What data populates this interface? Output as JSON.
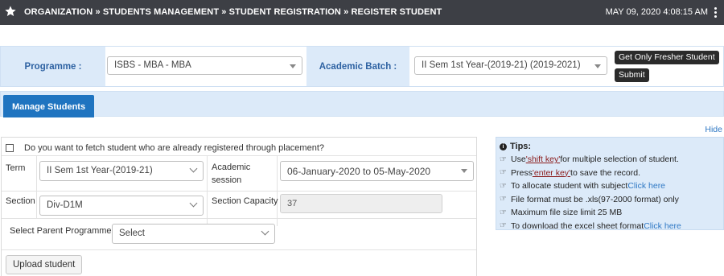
{
  "topbar": {
    "icon": "star-icon",
    "breadcrumb": "ORGANIZATION » STUDENTS MANAGEMENT » STUDENT REGISTRATION » REGISTER STUDENT",
    "datetime": "MAY 09, 2020   4:08:15 AM"
  },
  "filter": {
    "programme_label": "Programme :",
    "programme_value": "ISBS - MBA - MBA",
    "batch_label": "Academic Batch :",
    "batch_value": "II Sem 1st Year-(2019-21) (2019-2021)",
    "fresher_button": "Get Only Fresher Student",
    "submit_button": "Submit"
  },
  "tab": {
    "label": "Manage Students"
  },
  "hide_link": "Hide",
  "form": {
    "placement_question": "Do you want to fetch student who are already registered through placement?",
    "term_label": "Term",
    "term_value": "II Sem 1st Year-(2019-21)",
    "session_label_1": "Academic",
    "session_label_2": "session",
    "session_value": "06-January-2020 to 05-May-2020",
    "section_label": "Section",
    "section_value": "Div-D1M",
    "capacity_label": "Section Capacity",
    "capacity_value": "37",
    "parent_label": "Select Parent Programme",
    "parent_value": "Select",
    "upload_button": "Upload student"
  },
  "tips": {
    "title": "Tips:",
    "items": [
      {
        "pre": "Use ",
        "key": "'shift key'",
        "post": " for multiple selection of student."
      },
      {
        "pre": "Press ",
        "key": "'enter key'",
        "post": " to save the record."
      },
      {
        "pre": "To allocate student with subject ",
        "link": "Click here"
      },
      {
        "pre": "File format must be .xls(97-2000 format) only"
      },
      {
        "pre": "Maximum file size limit 25 MB"
      },
      {
        "pre": "To download the excel sheet format ",
        "link": "Click here"
      }
    ]
  },
  "colors": {
    "topbar": "#3d3f45",
    "label_bg": "#dceaf9",
    "label_text": "#2e62a2",
    "tab_active": "#1f74c0",
    "link": "#2f78c4"
  }
}
